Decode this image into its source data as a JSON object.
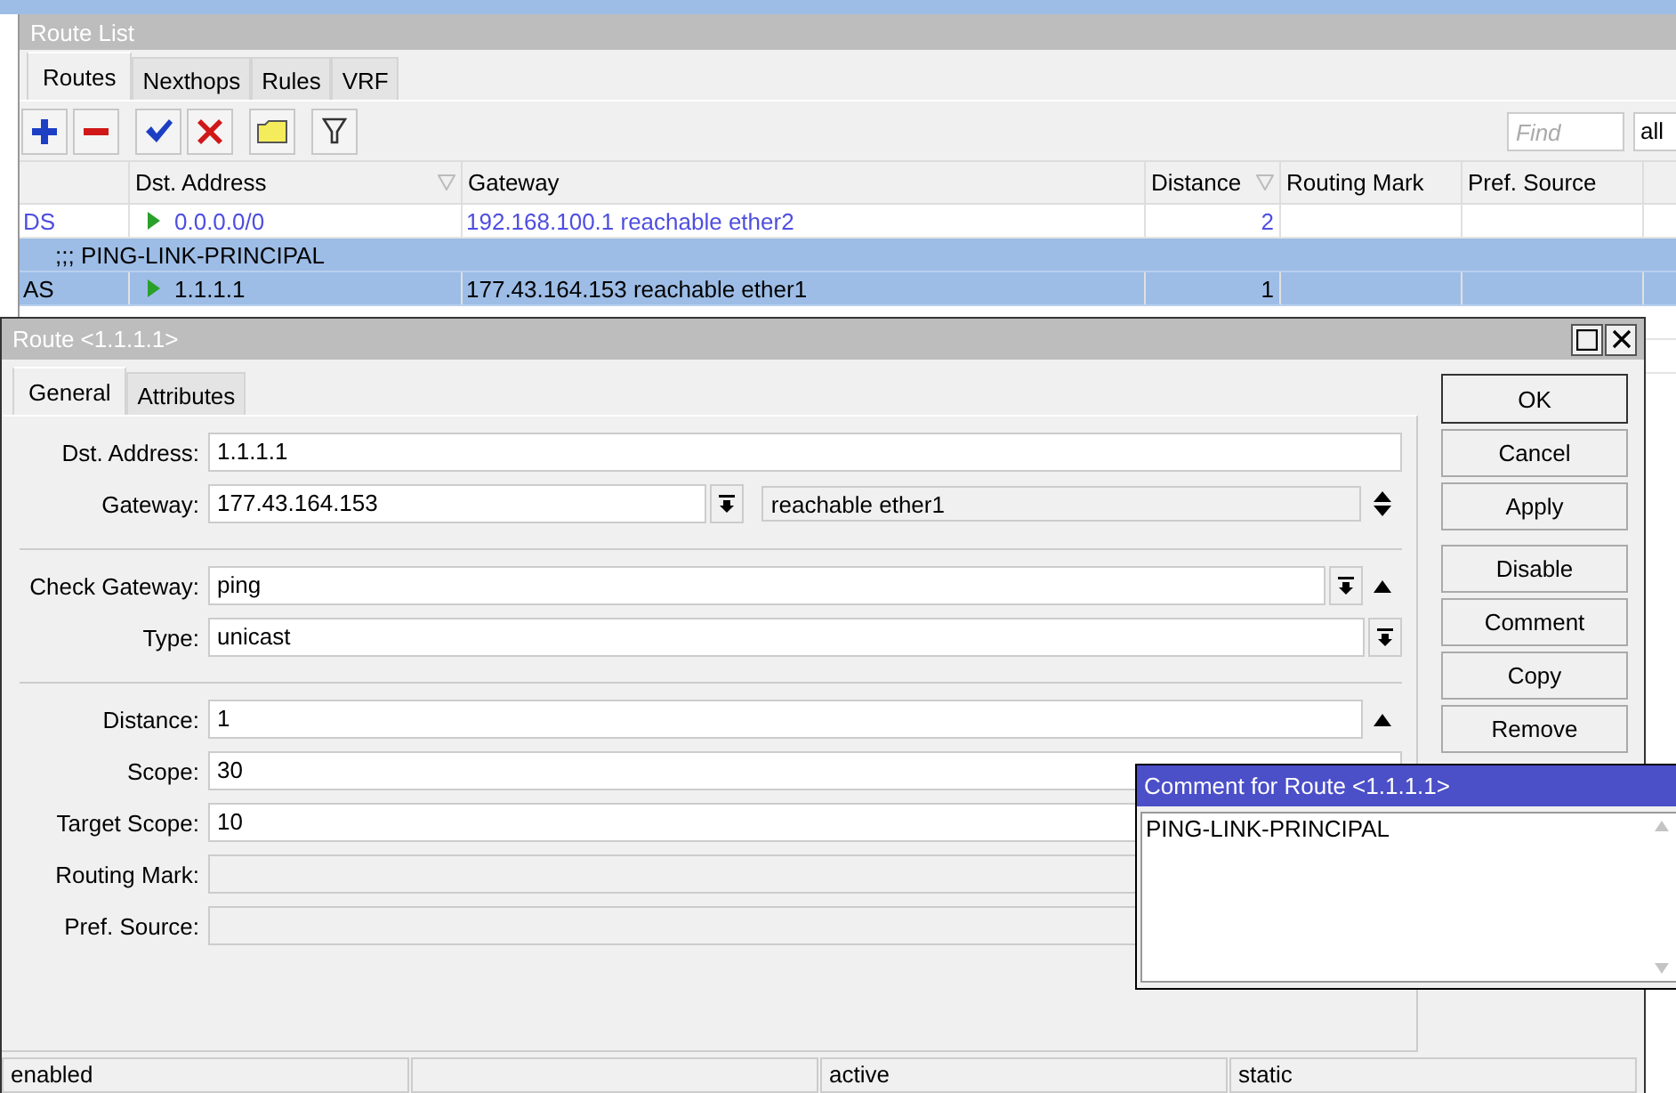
{
  "route_list": {
    "title": "Route List",
    "tabs": [
      {
        "label": "Routes",
        "selected": true
      },
      {
        "label": "Nexthops",
        "selected": false
      },
      {
        "label": "Rules",
        "selected": false
      },
      {
        "label": "VRF",
        "selected": false
      }
    ],
    "find": {
      "placeholder": "Find"
    },
    "filter": {
      "value": "all"
    },
    "columns": [
      {
        "sortable": false
      },
      {
        "label": "Dst. Address",
        "sortable": true
      },
      {
        "label": "Gateway"
      },
      {
        "label": "Distance",
        "sortable": true
      },
      {
        "label": "Routing Mark"
      },
      {
        "label": "Pref. Source"
      }
    ],
    "rows": [
      {
        "kind": "route",
        "flags": "DS",
        "dst": "0.0.0.0/0",
        "gateway": "192.168.100.1 reachable ether2",
        "distance": "2",
        "dynamic": true,
        "selected": false
      },
      {
        "kind": "comment",
        "text": ";;; PING-LINK-PRINCIPAL",
        "selected": true
      },
      {
        "kind": "route",
        "flags": "AS",
        "dst": "1.1.1.1",
        "gateway": "177.43.164.153 reachable ether1",
        "distance": "1",
        "dynamic": false,
        "selected": true
      }
    ]
  },
  "route_dialog": {
    "title": "Route <1.1.1.1>",
    "tabs": [
      {
        "label": "General",
        "selected": true
      },
      {
        "label": "Attributes",
        "selected": false
      }
    ],
    "groups": [
      [
        {
          "label": "Dst. Address:",
          "value": "1.1.1.1",
          "disabled": false,
          "dropdown": false,
          "collapse": false
        },
        {
          "label": "Gateway:",
          "value": "177.43.164.153",
          "disabled": false,
          "dropdown": true,
          "collapse": false,
          "status": "reachable ether1"
        }
      ],
      [
        {
          "label": "Check Gateway:",
          "value": "ping",
          "disabled": false,
          "dropdown": true,
          "collapse": true
        },
        {
          "label": "Type:",
          "value": "unicast",
          "disabled": false,
          "dropdown": true,
          "collapse": false
        }
      ],
      [
        {
          "label": "Distance:",
          "value": "1",
          "disabled": false,
          "dropdown": false,
          "collapse": true
        },
        {
          "label": "Scope:",
          "value": "30",
          "disabled": false,
          "dropdown": false,
          "collapse": false
        },
        {
          "label": "Target Scope:",
          "value": "10",
          "disabled": false,
          "dropdown": false,
          "collapse": false
        },
        {
          "label": "Routing Mark:",
          "disabled": true,
          "dropdown": false,
          "collapse": false
        },
        {
          "label": "Pref. Source:",
          "disabled": true,
          "dropdown": false,
          "collapse": false
        }
      ]
    ],
    "button_groups": [
      [
        "OK",
        "Cancel",
        "Apply"
      ],
      [
        "Disable",
        "Comment",
        "Copy",
        "Remove"
      ]
    ],
    "status_bar": {
      "column_1": "enabled",
      "column_3": "active",
      "column_4": "static"
    }
  },
  "comment_dialog": {
    "title": "Comment for Route <1.1.1.1>",
    "text": "PING-LINK-PRINCIPAL"
  }
}
